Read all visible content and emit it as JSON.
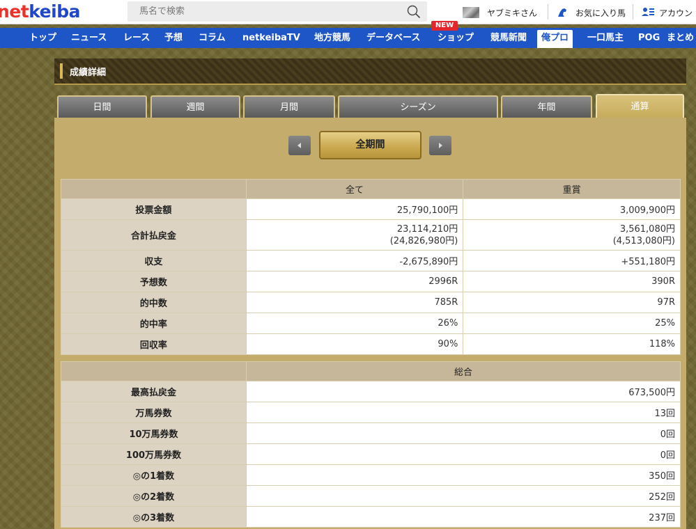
{
  "header": {
    "logo_net": "net",
    "logo_keiba": "keiba",
    "search_placeholder": "馬名で検索",
    "user_name": "ヤブミキさん",
    "favorites": "お気に入り馬",
    "account": "アカウン"
  },
  "nav": {
    "items": [
      "トップ",
      "ニュース",
      "レース",
      "予想",
      "コラム",
      "netkeibaTV",
      "地方競馬",
      "データベース",
      "ショップ",
      "競馬新聞",
      "俺プロ",
      "一口馬主",
      "POG",
      "まとめ"
    ],
    "active": "俺プロ",
    "new_badge": "NEW"
  },
  "section": {
    "title": "成績詳細"
  },
  "tabs": [
    "日間",
    "週間",
    "月間",
    "シーズン",
    "年間",
    "通算"
  ],
  "active_tab": "通算",
  "period": {
    "current": "全期間"
  },
  "summary": {
    "columns": [
      "全て",
      "重賞"
    ],
    "rows": [
      {
        "label": "投票金額",
        "all": "25,790,100円",
        "grade": "3,009,900円"
      },
      {
        "label": "合計払戻金",
        "all": "23,114,210円",
        "all_sub": "(24,826,980円)",
        "grade": "3,561,080円",
        "grade_sub": "(4,513,080円)"
      },
      {
        "label": "収支",
        "all": "-2,675,890円",
        "grade": "+551,180円"
      },
      {
        "label": "予想数",
        "all": "2996R",
        "grade": "390R"
      },
      {
        "label": "的中数",
        "all": "785R",
        "grade": "97R"
      },
      {
        "label": "的中率",
        "all": "26%",
        "grade": "25%"
      },
      {
        "label": "回収率",
        "all": "90%",
        "grade": "118%"
      }
    ]
  },
  "overall": {
    "column": "総合",
    "rows": [
      {
        "label": "最高払戻金",
        "value": "673,500円"
      },
      {
        "label": "万馬券数",
        "value": "13回"
      },
      {
        "label": "10万馬券数",
        "value": "0回"
      },
      {
        "label": "100万馬券数",
        "value": "0回"
      },
      {
        "label": "◎の1着数",
        "value": "350回"
      },
      {
        "label": "◎の2着数",
        "value": "252回"
      },
      {
        "label": "◎の3着数",
        "value": "237回"
      }
    ]
  },
  "colors": {
    "nav_blue": "#1e56c8",
    "logo_red": "#e8322a",
    "panel_gold": "#c4ad6c"
  }
}
